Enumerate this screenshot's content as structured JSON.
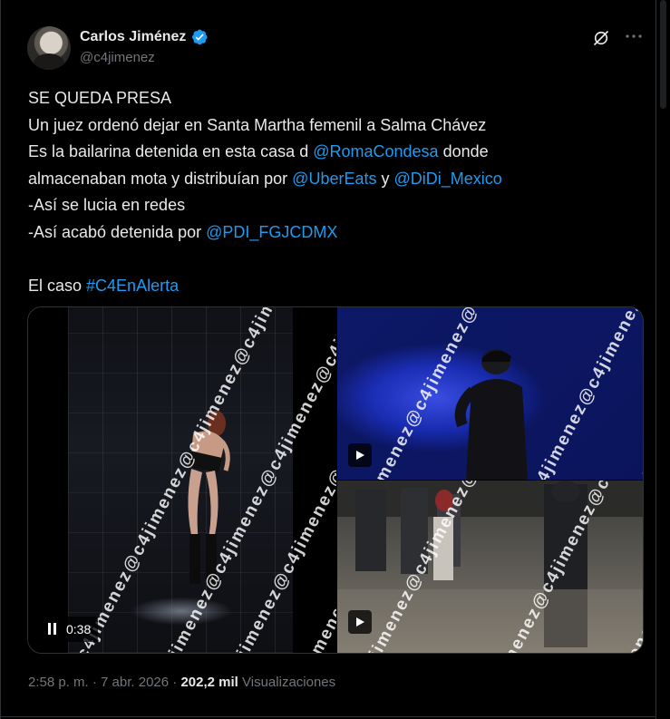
{
  "author": {
    "display_name": "Carlos Jiménez",
    "handle": "@c4jimenez",
    "verified": true
  },
  "header_icons": [
    "grok-icon",
    "more-icon"
  ],
  "tweet": {
    "line1": "SE QUEDA PRESA",
    "line2": "Un juez ordenó dejar en Santa Martha femenil a Salma Chávez",
    "line3_pre": "Es la bailarina detenida en esta casa d ",
    "line3_link": "@RomaCondesa",
    "line3_post": " donde",
    "line4_pre": "almacenaban mota y distribuían por ",
    "line4_link1": "@UberEats",
    "line4_mid": " y ",
    "line4_link2": "@DiDi_Mexico",
    "line5": "-Así se lucia en redes",
    "line6_pre": "-Así acabó detenida por ",
    "line6_link": "@PDI_FGJCDMX",
    "line8_pre": "El caso ",
    "line8_link": "#C4EnAlerta"
  },
  "media": {
    "watermark": "@c4jimenez@c4jimenez@c4jimenez@c4jimenez",
    "video_time": "0:38"
  },
  "meta": {
    "time": "2:58 p. m.",
    "separator": " · ",
    "date": "7 abr. 2026",
    "views_count": "202,2 mil",
    "views_label": " Visualizaciones"
  },
  "colors": {
    "background": "#000000",
    "text": "#e7e9ea",
    "secondary": "#71767b",
    "link": "#1d9bf0",
    "verified": "#1d9bf0"
  }
}
